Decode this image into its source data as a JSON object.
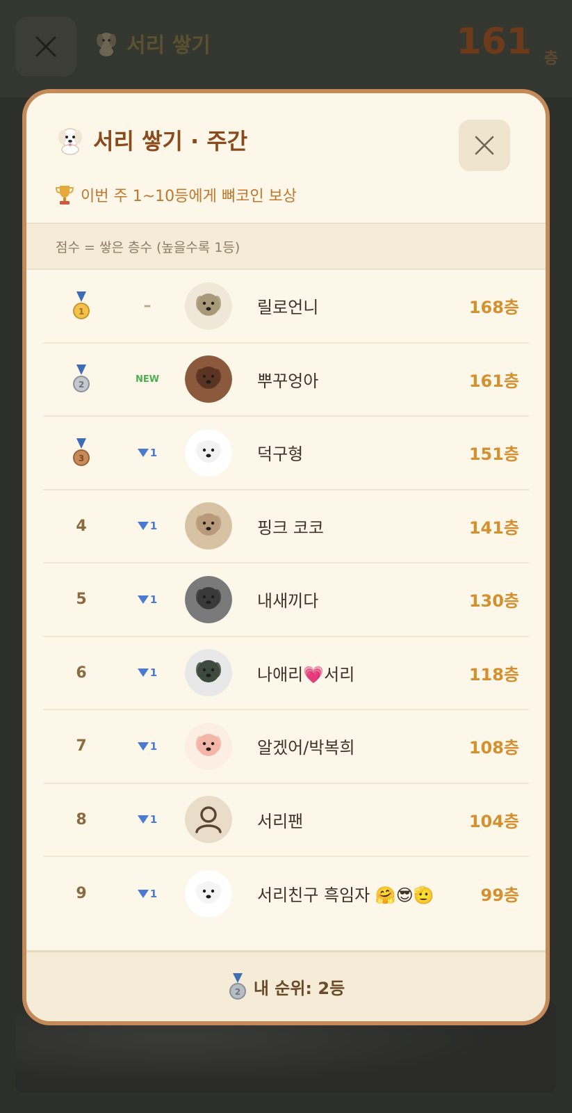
{
  "background": {
    "title": "서리 쌓기",
    "score": "161",
    "score_unit": "층"
  },
  "modal": {
    "title": "서리 쌓기 · 주간",
    "reward_text": "이번 주 1~10등에게 뼈코인 보상",
    "score_rule": "점수 = 쌓은 층수 (높을수록 1등)",
    "footer_text": "내 순위: 2등"
  },
  "ranking": [
    {
      "rank": "1",
      "medal": "gold",
      "change": "–",
      "change_type": "same",
      "name": "릴로언니",
      "score": "168층"
    },
    {
      "rank": "2",
      "medal": "silver",
      "change": "NEW",
      "change_type": "new",
      "name": "뿌꾸엉아",
      "score": "161층"
    },
    {
      "rank": "3",
      "medal": "bronze",
      "change": "1",
      "change_type": "down",
      "name": "덕구형",
      "score": "151층"
    },
    {
      "rank": "4",
      "medal": "",
      "change": "1",
      "change_type": "down",
      "name": "핑크 코코",
      "score": "141층"
    },
    {
      "rank": "5",
      "medal": "",
      "change": "1",
      "change_type": "down",
      "name": "내새끼다",
      "score": "130층"
    },
    {
      "rank": "6",
      "medal": "",
      "change": "1",
      "change_type": "down",
      "name": "나애리💗서리",
      "score": "118층"
    },
    {
      "rank": "7",
      "medal": "",
      "change": "1",
      "change_type": "down",
      "name": "알겠어/박복희",
      "score": "108층"
    },
    {
      "rank": "8",
      "medal": "",
      "change": "1",
      "change_type": "down",
      "name": "서리팬",
      "score": "104층"
    },
    {
      "rank": "9",
      "medal": "",
      "change": "1",
      "change_type": "down",
      "name": "서리친구 흑임자 🤗😎🫡",
      "score": "99층"
    }
  ],
  "colors": {
    "accent": "#d4902e",
    "title": "#8a4a1c",
    "border": "#c48a5a",
    "down": "#4a7bd1",
    "new": "#4caf50"
  }
}
